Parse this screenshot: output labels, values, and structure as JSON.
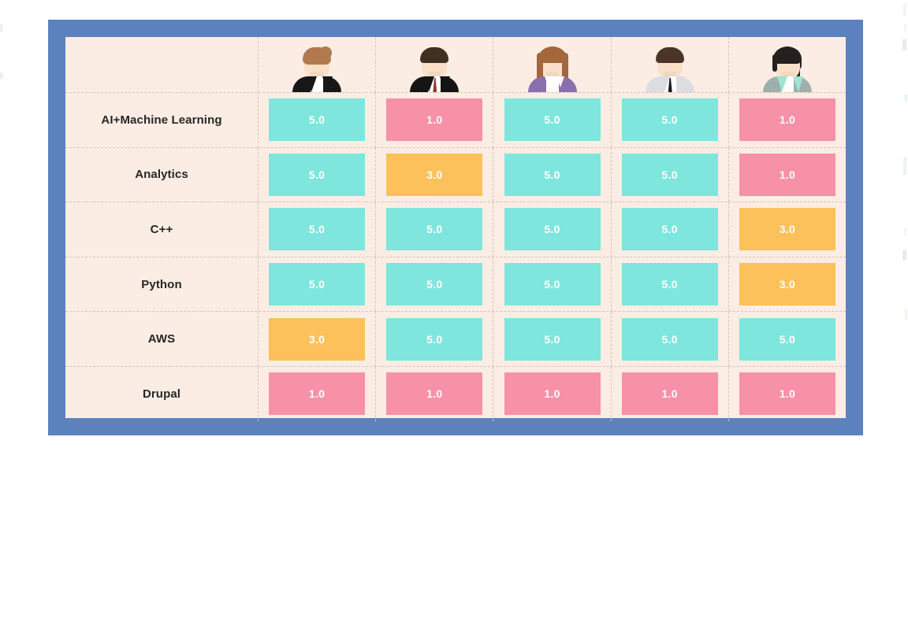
{
  "matrix": {
    "frame_color": "#5b82bc",
    "table_background": "#fcede4",
    "separator_color": "#cfc3bd",
    "columns": [
      {
        "id": "person-1",
        "avatar": {
          "name": "avatar-woman-brown-bun-black-jacket",
          "hair_color": "#b07a4e",
          "skin_color": "#fae0c8",
          "body_color": "#171717",
          "shirt_color": "#ffffff",
          "accent_color": "#171717",
          "style": "bun"
        }
      },
      {
        "id": "person-2",
        "avatar": {
          "name": "avatar-man-dark-hair-black-suit-red-tie",
          "hair_color": "#40301f",
          "skin_color": "#fae0c8",
          "body_color": "#141414",
          "shirt_color": "#ffffff",
          "accent_color": "#963a2b",
          "style": "short"
        }
      },
      {
        "id": "person-3",
        "avatar": {
          "name": "avatar-woman-long-brown-hair-purple-top",
          "hair_color": "#a4663c",
          "skin_color": "#fae0c8",
          "body_color": "#8a6fad",
          "shirt_color": "#ffffff",
          "accent_color": "#8a6fad",
          "style": "long"
        }
      },
      {
        "id": "person-4",
        "avatar": {
          "name": "avatar-man-dark-hair-grey-shirt-black-tie",
          "hair_color": "#4a3526",
          "skin_color": "#fae0c8",
          "body_color": "#dcdde1",
          "shirt_color": "#ffffff",
          "accent_color": "#1b1b1b",
          "style": "short"
        }
      },
      {
        "id": "person-5",
        "avatar": {
          "name": "avatar-woman-black-ponytail-mint-jacket",
          "hair_color": "#24201f",
          "skin_color": "#fae0c8",
          "body_color": "#9fb0ac",
          "shirt_color": "#ffffff",
          "accent_color": "#9fe3d4",
          "style": "ponytail"
        }
      }
    ],
    "rows": [
      {
        "label": "AI+Machine Learning",
        "scores": [
          "5.0",
          "1.0",
          "5.0",
          "5.0",
          "1.0"
        ]
      },
      {
        "label": "Analytics",
        "scores": [
          "5.0",
          "3.0",
          "5.0",
          "5.0",
          "1.0"
        ]
      },
      {
        "label": "C++",
        "scores": [
          "5.0",
          "5.0",
          "5.0",
          "5.0",
          "3.0"
        ]
      },
      {
        "label": "Python",
        "scores": [
          "5.0",
          "5.0",
          "5.0",
          "5.0",
          "3.0"
        ]
      },
      {
        "label": "AWS",
        "scores": [
          "3.0",
          "5.0",
          "5.0",
          "5.0",
          "5.0"
        ]
      },
      {
        "label": "Drupal",
        "scores": [
          "1.0",
          "1.0",
          "1.0",
          "1.0",
          "1.0"
        ]
      }
    ],
    "score_colors": {
      "5.0": "#7ee6dc",
      "3.0": "#fcc15b",
      "1.0": "#f791a8"
    }
  }
}
